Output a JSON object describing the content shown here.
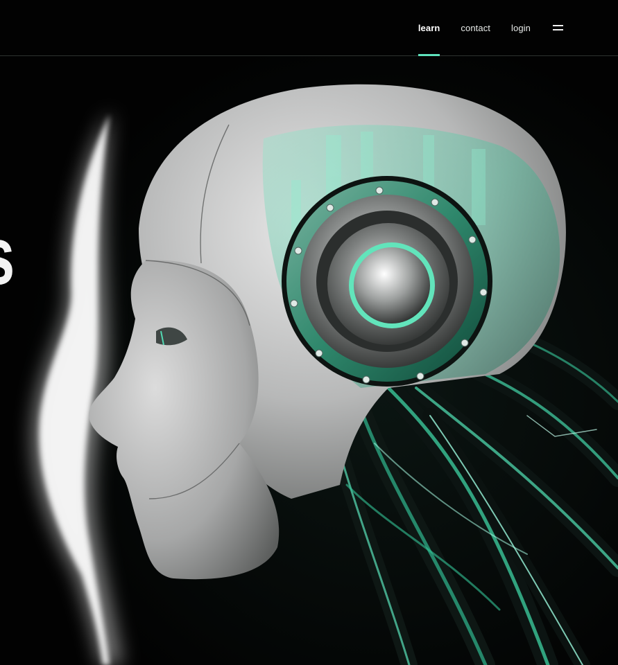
{
  "nav": {
    "items": [
      {
        "label": "learn",
        "active": true
      },
      {
        "label": "contact",
        "active": false
      },
      {
        "label": "login",
        "active": false
      }
    ],
    "menu_icon": "hamburger-menu-icon"
  },
  "hero": {
    "heading_fragment": "s",
    "image": "robot-head-illustration"
  },
  "colors": {
    "background": "#020202",
    "accent": "#5fe3bc",
    "text": "#e9ecea",
    "divider": "#2e3330"
  }
}
